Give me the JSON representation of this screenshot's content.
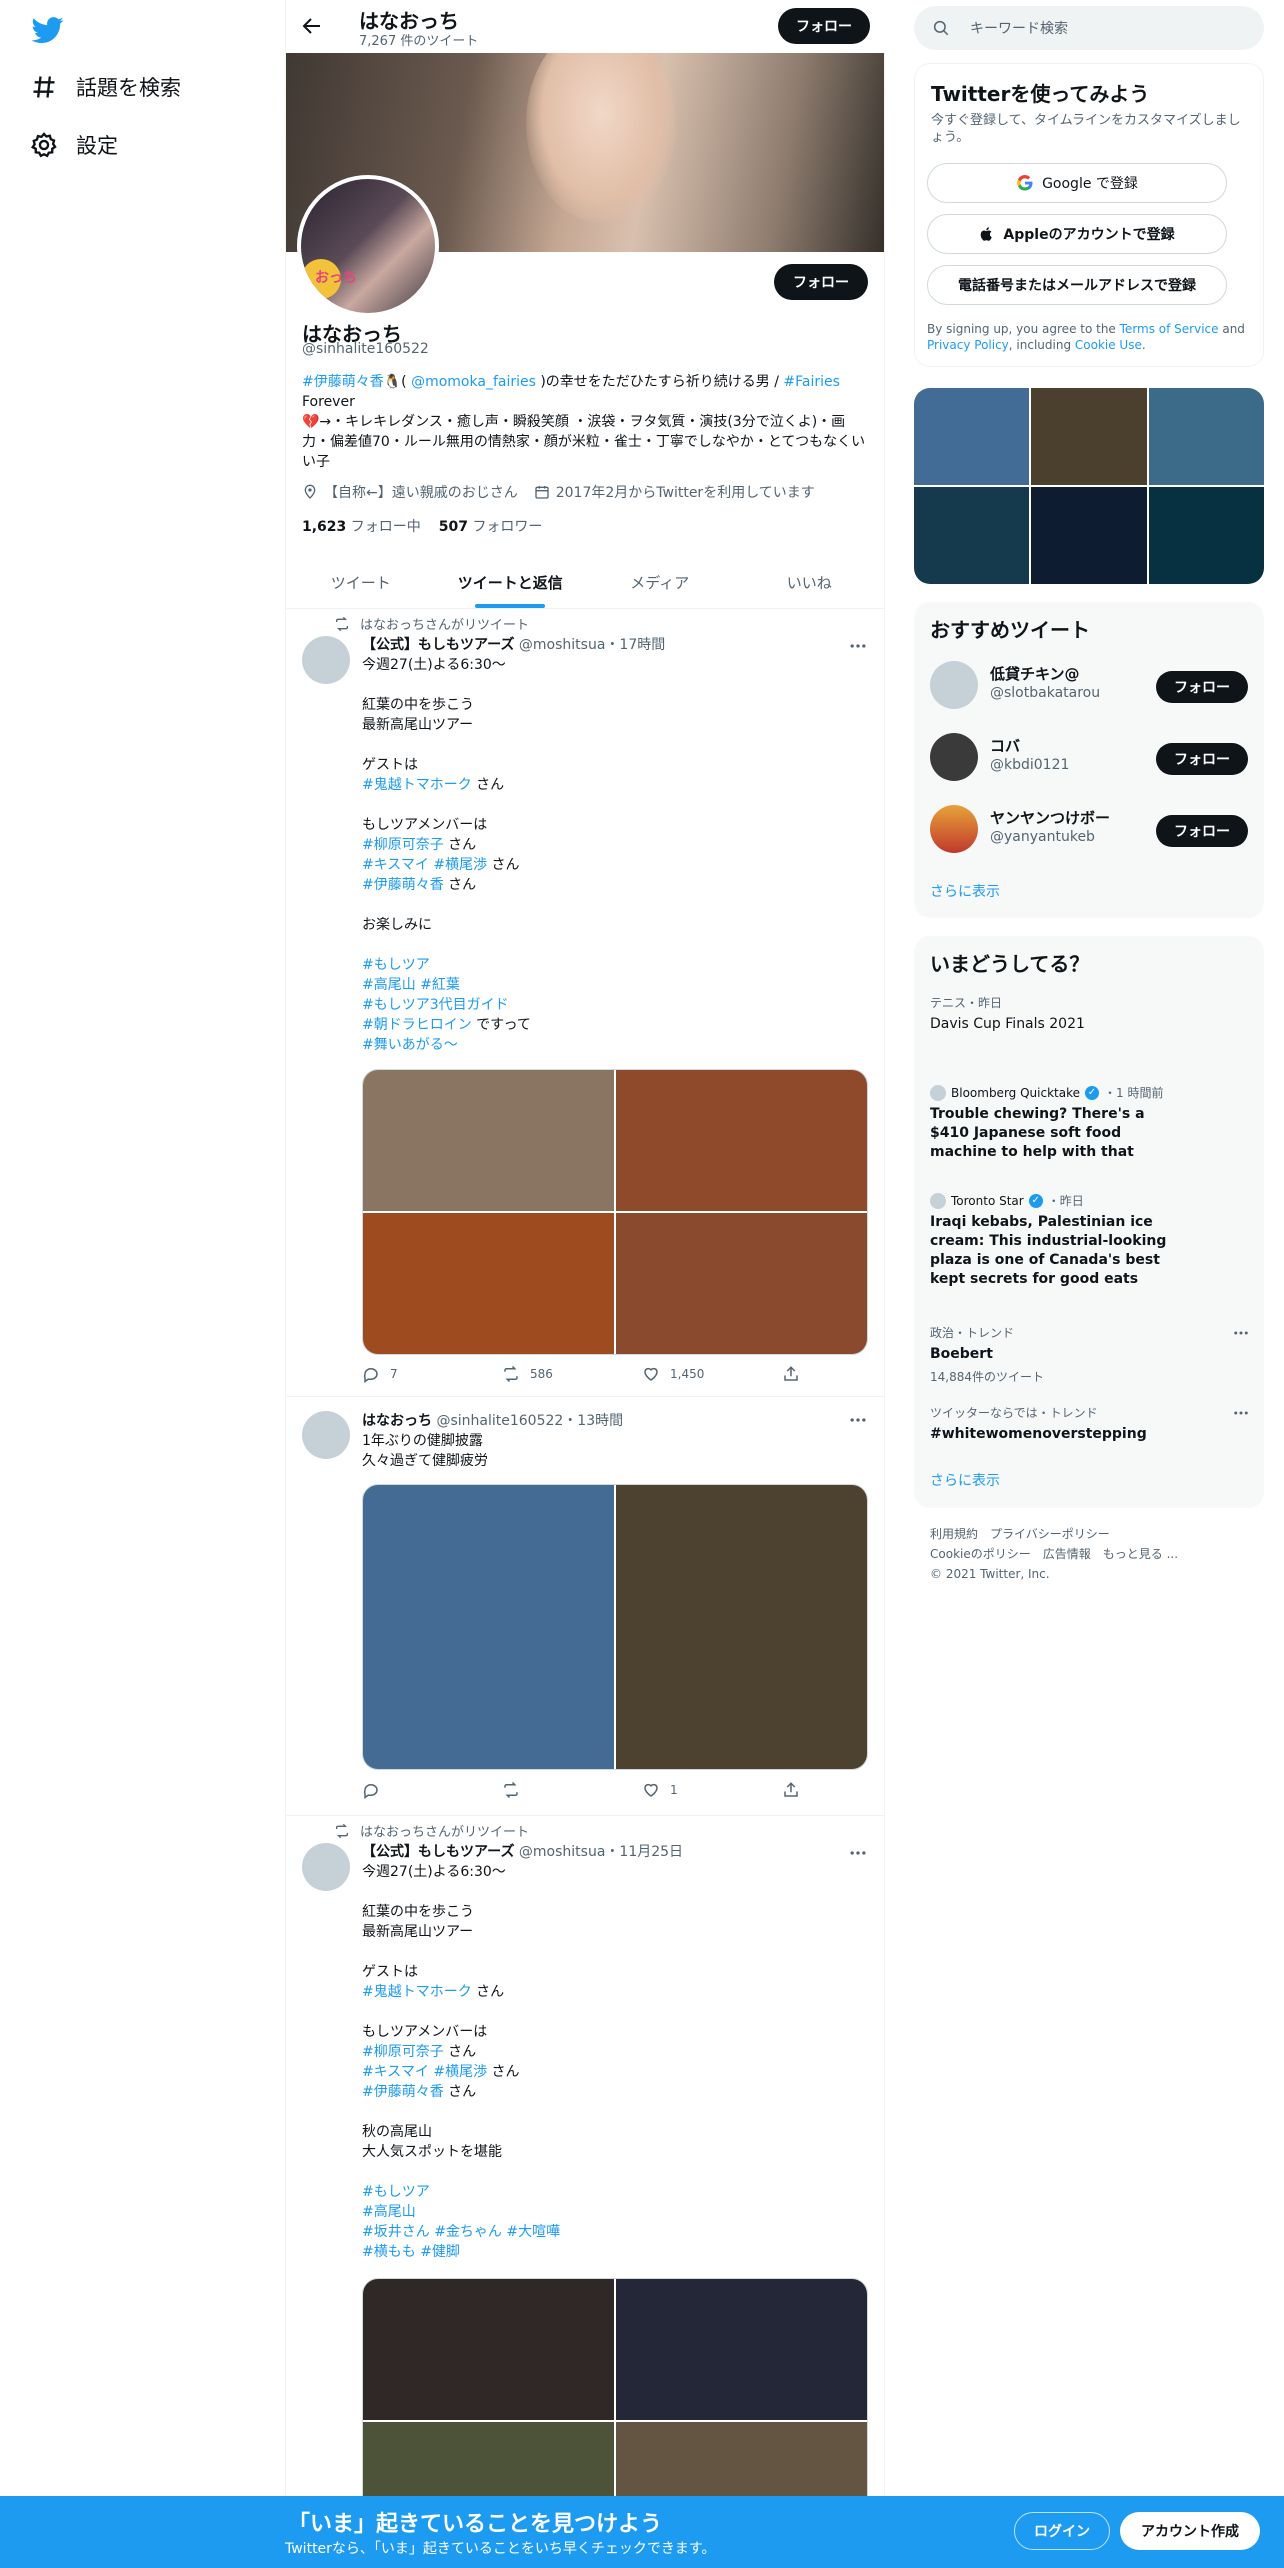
{
  "leftnav": {
    "explore_label": "話題を検索",
    "settings_label": "設定"
  },
  "header": {
    "name": "はなおっち",
    "tweet_count": "7,267 件のツイート",
    "follow_label": "フォロー"
  },
  "profile": {
    "name": "はなおっち",
    "handle": "@sinhalite160522",
    "follow_label": "フォロー",
    "avatar_text": "おっち",
    "bio": {
      "tag1": "#伊藤萌々香",
      "mid1": "( ",
      "mention": "@momoka_fairies",
      "mid2": " )の幸せをただひたすら祈り続ける男 / ",
      "tag2": "#Fairies",
      "line2": "Forever",
      "line3": "💔→・キレキレダンス・癒し声・瞬殺笑顔 ・涙袋・ヲタ気質・演技(3分で泣くよ)・画力・偏差値70・ルール無用の情熱家・顔が米粒・雀士・丁寧でしなやか・とてつもなくいい子"
    },
    "location": "【自称←】遠い親戚のおじさん",
    "joined": "2017年2月からTwitterを利用しています",
    "following_count": "1,623",
    "following_label": "フォロー中",
    "followers_count": "507",
    "followers_label": "フォロワー"
  },
  "tabs": [
    {
      "label": "ツイート"
    },
    {
      "label": "ツイートと返信"
    },
    {
      "label": "メディア"
    },
    {
      "label": "いいね"
    }
  ],
  "tweets": [
    {
      "context": "はなおっちさんがリツイート",
      "name": "【公式】もしもツアーズ",
      "handle": "@moshitsua",
      "time": "・17時間",
      "body_intro": "今週27(土)よる6:30〜\n\n紅葉の中を歩こう\n最新高尾山ツアー\n\nゲストは",
      "guest_tag": "#鬼越トマホーク",
      "san": " さん",
      "members_label": "もしツアメンバーは",
      "m1": "#柳原可奈子",
      "m2a": "#キスマイ",
      "m2b": "#横尾渉",
      "m3": "#伊藤萌々香",
      "closing": "お楽しみに",
      "h1": "#もしツア",
      "h2a": "#高尾山",
      "h2b": "#紅葉",
      "h3": "#もしツア3代目ガイド",
      "h4": "#朝ドラヒロイン",
      "h4suffix": " ですって",
      "h5": "#舞いあがる〜",
      "media_colors": [
        "#8a7562",
        "#8f4a2c",
        "#9e4b20",
        "#8a4a2e"
      ],
      "replies": "7",
      "retweets": "586",
      "likes": "1,450"
    },
    {
      "name": "はなおっち",
      "handle": "@sinhalite160522",
      "time": "・13時間",
      "body": "1年ぶりの健脚披露\n久々過ぎて健脚疲労",
      "media_colors": [
        "#436b94",
        "#4d4130"
      ],
      "replies": "",
      "retweets": "",
      "likes": "1"
    },
    {
      "context": "はなおっちさんがリツイート",
      "name": "【公式】もしもツアーズ",
      "handle": "@moshitsua",
      "time": "・11月25日",
      "body_intro": "今週27(土)よる6:30〜\n\n紅葉の中を歩こう\n最新高尾山ツアー\n\nゲストは",
      "guest_tag": "#鬼越トマホーク",
      "san": " さん",
      "members_label": "もしツアメンバーは",
      "m1": "#柳原可奈子",
      "m2a": "#キスマイ",
      "m2b": "#横尾渉",
      "m3": "#伊藤萌々香",
      "closing": "秋の高尾山\n大人気スポットを堪能",
      "h1": "#もしツア",
      "h2": "#高尾山",
      "h3a": "#坂井さん",
      "h3b": "#金ちゃん",
      "h3c": "#大喧嘩",
      "h4a": "#横もも",
      "h4b": "#健脚",
      "media_colors": [
        "#302826",
        "#232738",
        "#4c5338",
        "#645543"
      ]
    }
  ],
  "search": {
    "placeholder": "キーワード検索"
  },
  "signup": {
    "title": "Twitterを使ってみよう",
    "subtitle": "今すぐ登録して、タイムラインをカスタマイズしましょう。",
    "google": "Google で登録",
    "apple": "Appleのアカウントで登録",
    "phone": "電話番号またはメールアドレスで登録",
    "terms_pre": "By signing up, you agree to the ",
    "terms_link": "Terms of Service",
    "terms_and": " and ",
    "privacy_link": "Privacy Policy",
    "including": ", including ",
    "cookie_link": "Cookie Use",
    "period": "."
  },
  "media_grid_colors": [
    "#426b96",
    "#4b3f2e",
    "#3c6b8a",
    "#153a4d",
    "#0d1c30",
    "#073040"
  ],
  "recommend": {
    "title": "おすすめツイート",
    "users": [
      {
        "name": "低貸チキン@",
        "handle": "@slotbakatarou",
        "follow": "フォロー"
      },
      {
        "name": "コバ",
        "handle": "@kbdi0121",
        "follow": "フォロー"
      },
      {
        "name": "ヤンヤンつけボー",
        "handle": "@yanyantukeb",
        "follow": "フォロー"
      }
    ],
    "more": "さらに表示"
  },
  "trends": {
    "title": "いまどうしてる？",
    "items": [
      {
        "context": "テニス・昨日",
        "title": "Davis Cup Finals 2021"
      },
      {
        "context": "Bloomberg Quicktake",
        "time": "・1 時間前",
        "title": "Trouble chewing? There's a $410 Japanese soft food machine to help with that"
      },
      {
        "context": "Toronto Star",
        "time": "・昨日",
        "title": "Iraqi kebabs, Palestinian ice cream: This industrial-looking plaza is one of Canada's best kept secrets for good eats"
      },
      {
        "context": "政治・トレンド",
        "title": "Boebert",
        "count": "14,884件のツイート"
      },
      {
        "context": "ツイッターならでは・トレンド",
        "title": "#whitewomenoverstepping"
      }
    ],
    "more": "さらに表示"
  },
  "footer": {
    "terms": "利用規約",
    "privacy": "プライバシーポリシー",
    "cookie": "Cookieのポリシー",
    "ads": "広告情報",
    "more": "もっと見る ...",
    "copyright": "© 2021 Twitter, Inc."
  },
  "bottombar": {
    "title": "「いま」起きていることを見つけよう",
    "subtitle": "Twitterなら、「いま」起きていることをいち早くチェックできます。",
    "login": "ログイン",
    "signup": "アカウント作成"
  }
}
